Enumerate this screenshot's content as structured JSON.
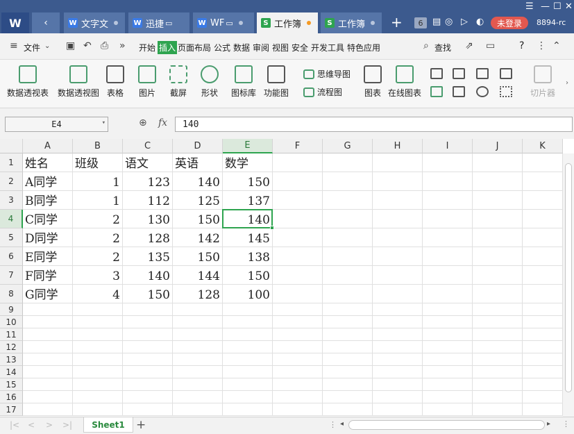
{
  "titlebar": {
    "app_logo": "W",
    "tab_nav_icon": "chevron-left-icon",
    "tabs": [
      {
        "label": "文字文",
        "type": "W",
        "color": "#3a7ae6"
      },
      {
        "label": "迅捷",
        "type": "W",
        "color": "#3a7ae6"
      },
      {
        "label": "WF",
        "type": "W",
        "color": "#3a7ae6"
      },
      {
        "label": "工作簿",
        "type": "S",
        "color": "#2ea44f"
      },
      {
        "label": "工作簿",
        "type": "S",
        "color": "#2ea44f"
      }
    ],
    "active_tab": 3,
    "add_tab": "+",
    "tab_count": "6",
    "login_label": "未登录",
    "user_id": "8894-rc",
    "window_controls": [
      "☰",
      "—",
      "☐",
      "✕"
    ]
  },
  "menubar": {
    "file_label": "文件",
    "items": [
      "开始",
      "插入",
      "页面布局",
      "公式",
      "数据",
      "审阅",
      "视图",
      "安全",
      "开发工具",
      "特色应用"
    ],
    "active_item": "插入",
    "search_label": "查找",
    "help": "?"
  },
  "ribbon": {
    "buttons": [
      {
        "label": "数据透视表"
      },
      {
        "label": "数据透视图"
      },
      {
        "label": "表格"
      },
      {
        "label": "图片"
      },
      {
        "label": "截屏"
      },
      {
        "label": "形状"
      },
      {
        "label": "图标库"
      },
      {
        "label": "功能图"
      },
      {
        "label": "图表"
      },
      {
        "label": "在线图表"
      },
      {
        "label": "切片器"
      }
    ],
    "small_buttons": [
      {
        "label": "思维导图"
      },
      {
        "label": "流程图"
      }
    ]
  },
  "formula": {
    "cell_ref": "E4",
    "fx_label": "fx",
    "value": "140"
  },
  "grid": {
    "columns": [
      "A",
      "B",
      "C",
      "D",
      "E",
      "F",
      "G",
      "H",
      "I",
      "J",
      "K"
    ],
    "selected_column": "E",
    "selected_row": 4,
    "rows": [
      "1",
      "2",
      "3",
      "4",
      "5",
      "6",
      "7",
      "8",
      "9",
      "10",
      "11",
      "12",
      "13",
      "14",
      "15",
      "16",
      "17"
    ],
    "data": [
      [
        "姓名",
        "班级",
        "语文",
        "英语",
        "数学"
      ],
      [
        "A同学",
        "1",
        "123",
        "140",
        "150"
      ],
      [
        "B同学",
        "1",
        "112",
        "125",
        "137"
      ],
      [
        "C同学",
        "2",
        "130",
        "150",
        "140"
      ],
      [
        "D同学",
        "2",
        "128",
        "142",
        "145"
      ],
      [
        "E同学",
        "2",
        "135",
        "150",
        "138"
      ],
      [
        "F同学",
        "3",
        "140",
        "144",
        "150"
      ],
      [
        "G同学",
        "4",
        "150",
        "128",
        "100"
      ]
    ]
  },
  "sheetbar": {
    "nav": [
      "|<",
      "<",
      ">",
      ">|"
    ],
    "sheet_tab": "Sheet1",
    "add_sheet": "+"
  }
}
